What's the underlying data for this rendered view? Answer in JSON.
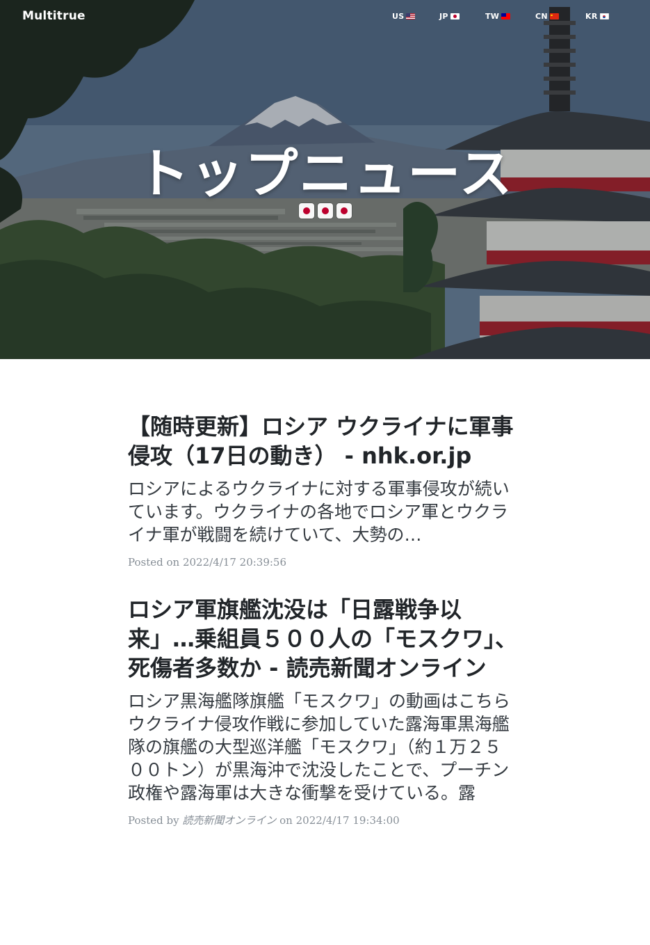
{
  "brand": "Multitrue",
  "nav": [
    {
      "label": "US",
      "flag": "us"
    },
    {
      "label": "JP",
      "flag": "jp"
    },
    {
      "label": "TW",
      "flag": "tw"
    },
    {
      "label": "CN",
      "flag": "cn"
    },
    {
      "label": "KR",
      "flag": "kr"
    }
  ],
  "hero": {
    "title": "トップニュース",
    "flags": [
      "jp",
      "jp",
      "jp"
    ]
  },
  "posts": [
    {
      "title": "【随時更新】ロシア ウクライナに軍事侵攻（17日の動き） - nhk.or.jp",
      "subtitle": "ロシアによるウクライナに対する軍事侵攻が続いています。ウクライナの各地でロシア軍とウクライナ軍が戦闘を続けていて、大勢の…",
      "meta_prefix": "Posted on",
      "author": "",
      "date": "2022/4/17 20:39:56"
    },
    {
      "title": "ロシア軍旗艦沈没は「日露戦争以来」…乗組員５００人の「モスクワ」、死傷者多数か - 読売新聞オンライン",
      "subtitle": "ロシア黒海艦隊旗艦「モスクワ」の動画はこちら　ウクライナ侵攻作戦に参加していた露海軍黒海艦隊の旗艦の大型巡洋艦「モスクワ」（約１万２５００トン）が黒海沖で沈没したことで、プーチン政権や露海軍は大きな衝撃を受けている。露",
      "meta_prefix": "Posted by",
      "author": "読売新聞オンライン",
      "meta_on": "on",
      "date": "2022/4/17 19:34:00"
    }
  ]
}
